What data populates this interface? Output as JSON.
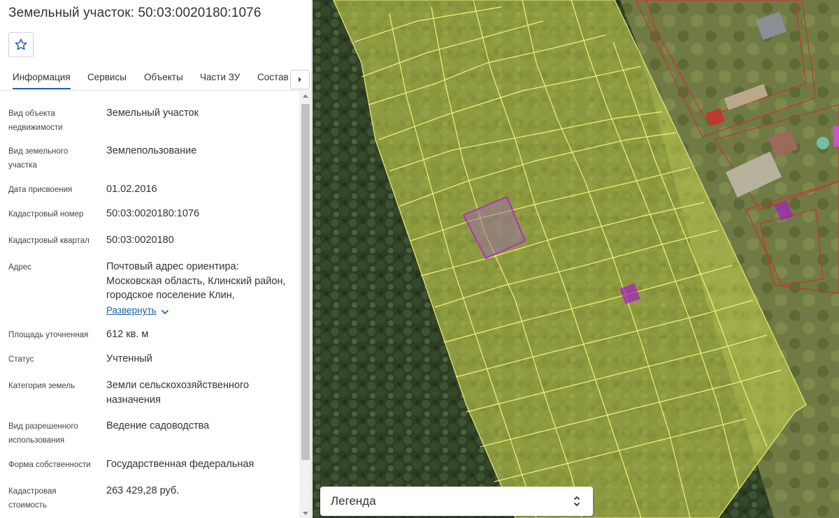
{
  "title": "Земельный участок: 50:03:0020180:1076",
  "favorite_icon": "star-outline-icon",
  "tabs": [
    {
      "label": "Информация",
      "active": true
    },
    {
      "label": "Сервисы"
    },
    {
      "label": "Объекты"
    },
    {
      "label": "Части ЗУ"
    },
    {
      "label": "Состав"
    }
  ],
  "tab_scroll_icon": "caret-right-icon",
  "info": [
    {
      "label": "Вид объекта недвижимости",
      "value": "Земельный участок"
    },
    {
      "label": "Вид земельного участка",
      "value": "Землепользование"
    },
    {
      "label": "Дата присвоения",
      "value": "01.02.2016"
    },
    {
      "label": "Кадастровый номер",
      "value": "50:03:0020180:1076"
    },
    {
      "label": "Кадастровый квартал",
      "value": "50:03:0020180"
    },
    {
      "label": "Адрес",
      "value": "Почтовый адрес ориентира: Московская область, Клинский район, городское поселение Клин,"
    },
    {
      "label": "Площадь уточненная",
      "value": "612 кв. м"
    },
    {
      "label": "Статус",
      "value": "Учтенный"
    },
    {
      "label": "Категория земель",
      "value": "Земли сельскохозяйственного назначения"
    },
    {
      "label": "Вид разрешенного использования",
      "value": "Ведение садоводства"
    },
    {
      "label": "Форма собственности",
      "value": "Государственная федеральная"
    },
    {
      "label": "Кадастровая стоимость",
      "value": "263 429,28 руб."
    }
  ],
  "address_expand_label": "Развернуть",
  "legend": {
    "label": "Легенда",
    "icon": "chevron-up-down-icon"
  },
  "colors": {
    "accent": "#1f5fa8",
    "parcel_fill": "#d8e04a",
    "parcel_border": "#f2f27a",
    "selected_parcel": "#a020c0",
    "neighbor_border": "#c0392b"
  }
}
